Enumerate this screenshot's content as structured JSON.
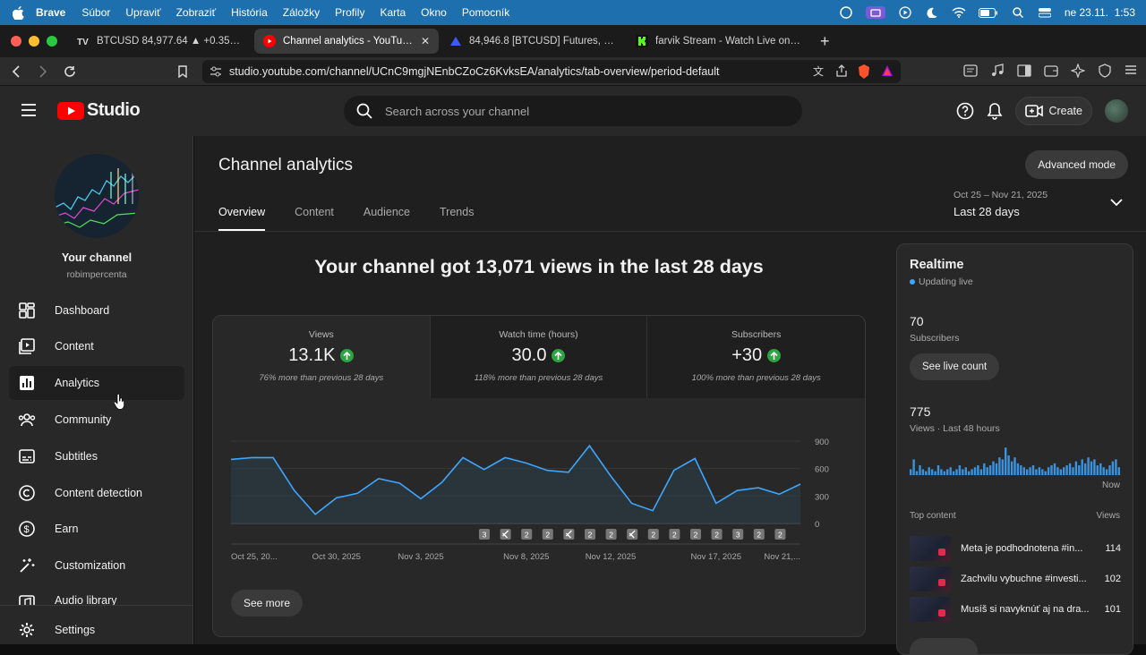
{
  "os_menu": {
    "app": "Brave",
    "items": [
      "Súbor",
      "Upraviť",
      "Zobraziť",
      "História",
      "Záložky",
      "Profily",
      "Karta",
      "Okno",
      "Pomocník"
    ],
    "clock": "ne 23.11.  1:53"
  },
  "browser": {
    "tabs": [
      {
        "title": "BTCUSD 84,977.64 ▲ +0.35% Un",
        "active": false
      },
      {
        "title": "Channel analytics - YouTube S",
        "active": true
      },
      {
        "title": "84,946.8 [BTCUSD] Futures, Coin",
        "active": false
      },
      {
        "title": "farvik Stream - Watch Live on Kick",
        "active": false
      }
    ],
    "url": "studio.youtube.com/channel/UCnC9mgjNEnbCZoCz6KvksEA/analytics/tab-overview/period-default"
  },
  "header": {
    "logo_text": "Studio",
    "search_placeholder": "Search across your channel",
    "create_label": "Create"
  },
  "sidebar": {
    "channel_title": "Your channel",
    "channel_handle": "robimpercenta",
    "items": [
      {
        "label": "Dashboard",
        "icon": "dashboard-icon"
      },
      {
        "label": "Content",
        "icon": "content-icon"
      },
      {
        "label": "Analytics",
        "icon": "analytics-icon"
      },
      {
        "label": "Community",
        "icon": "community-icon"
      },
      {
        "label": "Subtitles",
        "icon": "subtitles-icon"
      },
      {
        "label": "Content detection",
        "icon": "copyright-icon"
      },
      {
        "label": "Earn",
        "icon": "dollar-icon"
      },
      {
        "label": "Customization",
        "icon": "magic-wand-icon"
      },
      {
        "label": "Audio library",
        "icon": "audio-library-icon"
      }
    ],
    "settings_label": "Settings"
  },
  "main": {
    "title": "Channel analytics",
    "advanced_label": "Advanced mode",
    "date_range": {
      "sub": "Oct 25 – Nov 21, 2025",
      "main": "Last 28 days"
    },
    "tabs": [
      "Overview",
      "Content",
      "Audience",
      "Trends"
    ],
    "headline": "Your channel got 13,071 views in the last 28 days",
    "metrics": [
      {
        "label": "Views",
        "value": "13.1K",
        "note": "76% more than previous 28 days"
      },
      {
        "label": "Watch time (hours)",
        "value": "30.0",
        "note": "118% more than previous 28 days"
      },
      {
        "label": "Subscribers",
        "value": "+30",
        "note": "100% more than previous 28 days"
      }
    ],
    "see_more": "See more"
  },
  "realtime": {
    "title": "Realtime",
    "status": "Updating live",
    "subscribers": "70",
    "subscribers_label": "Subscribers",
    "see_live_count": "See live count",
    "views": "775",
    "views_label": "Views · Last 48 hours",
    "now_label": "Now",
    "top_content_label": "Top content",
    "views_col": "Views",
    "top_content": [
      {
        "title": "Meta je podhodnotena #in...",
        "views": "114"
      },
      {
        "title": "Zachvilu vybuchne #investi...",
        "views": "102"
      },
      {
        "title": "Musíš si navyknúť aj na dra...",
        "views": "101"
      }
    ]
  },
  "chart_data": {
    "type": "area",
    "series_name": "Views",
    "x": [
      "Oct 25",
      "Oct 26",
      "Oct 27",
      "Oct 28",
      "Oct 29",
      "Oct 30",
      "Oct 31",
      "Nov 1",
      "Nov 2",
      "Nov 3",
      "Nov 4",
      "Nov 5",
      "Nov 6",
      "Nov 7",
      "Nov 8",
      "Nov 9",
      "Nov 10",
      "Nov 11",
      "Nov 12",
      "Nov 13",
      "Nov 14",
      "Nov 15",
      "Nov 16",
      "Nov 17",
      "Nov 18",
      "Nov 19",
      "Nov 20",
      "Nov 21"
    ],
    "y": [
      700,
      720,
      720,
      360,
      100,
      280,
      330,
      490,
      440,
      270,
      450,
      720,
      590,
      720,
      660,
      580,
      560,
      850,
      520,
      220,
      140,
      580,
      710,
      220,
      360,
      390,
      320,
      430
    ],
    "x_tick_labels": [
      "Oct 25, 20...",
      "Oct 30, 2025",
      "Nov 3, 2025",
      "Nov 8, 2025",
      "Nov 12, 2025",
      "Nov 17, 2025",
      "Nov 21,..."
    ],
    "y_ticks": [
      0,
      300,
      600,
      900
    ],
    "ylim": [
      0,
      900
    ],
    "markers": [
      "3",
      "shorts",
      "2",
      "2",
      "shorts",
      "2",
      "2",
      "shorts",
      "2",
      "2",
      "2",
      "2",
      "3",
      "2",
      "2"
    ],
    "grid": true,
    "colors": {
      "line": "#3ea6ff",
      "fill": "#2b3e47"
    }
  },
  "colors": {
    "accent": "#3ea6ff",
    "up": "#2ba640",
    "yt_red": "#ff0000"
  }
}
